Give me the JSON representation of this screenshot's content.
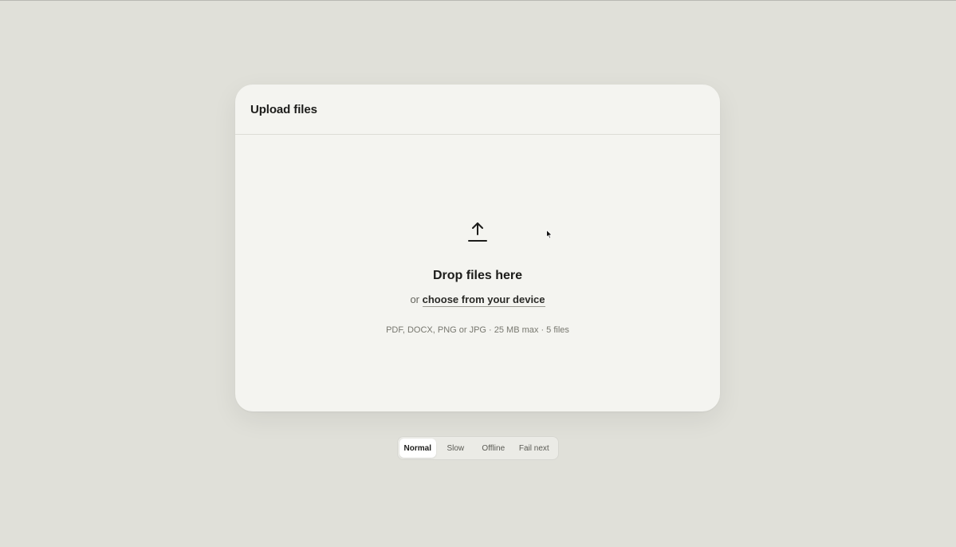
{
  "card": {
    "title": "Upload files"
  },
  "dropzone": {
    "icon": "upload-arrow-icon",
    "title": "Drop files here",
    "or_text": "or",
    "choose_link": "choose from your device",
    "hint": "PDF, DOCX, PNG or JPG · 25 MB max · 5 files"
  },
  "mode_switch": {
    "selected": "Normal",
    "options": [
      "Normal",
      "Slow",
      "Offline",
      "Fail next"
    ]
  },
  "colors": {
    "page_background": "#e0e0d9",
    "card_background": "#f4f4f0",
    "text_primary": "#1c1c1a"
  }
}
